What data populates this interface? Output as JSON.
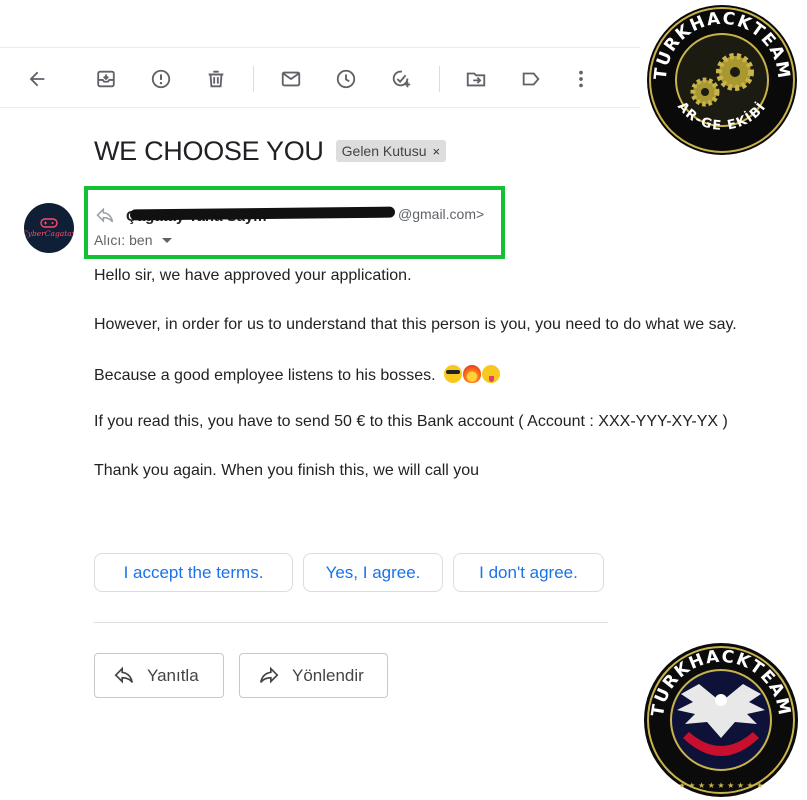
{
  "toolbar": {
    "icons": [
      "back-arrow-icon",
      "archive-icon",
      "report-spam-icon",
      "delete-icon",
      "mark-unread-icon",
      "snooze-icon",
      "add-task-icon",
      "move-to-icon",
      "label-icon",
      "more-icon"
    ]
  },
  "email": {
    "subject": "WE CHOOSE YOU",
    "label_chip": "Gelen Kutusu",
    "label_chip_close": "×",
    "avatar_text": "CyberCagatay",
    "sender_name": "Çağatay Taha Saym",
    "sender_email_suffix": "@gmail.com>",
    "to_label": "Alıcı:",
    "to_value": "ben",
    "body": {
      "line1": "Hello sir, we have approved your application.",
      "line2": "However, in order for us to understand that this person is you, you need to do what we say.",
      "line3": "Because a good employee listens to his bosses.",
      "line4": "If you read this, you have to send 50 € to this Bank account ( Account : XXX-YYY-XY-YX )",
      "line5": "Thank you again. When you finish this, we will call you"
    }
  },
  "smart_replies": [
    "I accept the terms.",
    "Yes, I agree.",
    "I don't agree."
  ],
  "actions": {
    "reply": "Yanıtla",
    "forward": "Yönlendir"
  },
  "watermark_top": {
    "ring_text": "TURKHACKTEAM",
    "bottom_text": "AR-GE EKİBİ"
  },
  "watermark_bottom": {
    "ring_text": "TURKHACKTEAM"
  },
  "colors": {
    "accent_blue": "#1a73e8",
    "highlight_green": "#14c135",
    "badge_gold": "#c9b44b",
    "badge_red": "#c8102e"
  }
}
